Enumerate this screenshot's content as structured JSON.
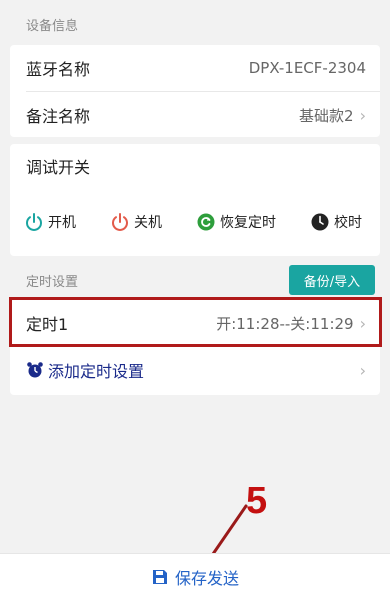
{
  "device_info": {
    "header": "设备信息",
    "bluetooth_label": "蓝牙名称",
    "bluetooth_value": "DPX-1ECF-2304",
    "note_label": "备注名称",
    "note_value": "基础款2"
  },
  "debug": {
    "title": "调试开关",
    "power_on": "开机",
    "power_off": "关机",
    "restore_timer": "恢复定时",
    "calibrate_time": "校时"
  },
  "timer_settings": {
    "header": "定时设置",
    "backup_button": "备份/导入",
    "timer1_label": "定时1",
    "timer1_value": "开:11:28--关:11:29",
    "add_timer": "添加定时设置"
  },
  "bottom": {
    "save_send": "保存发送"
  },
  "annotation": {
    "step_number": "5"
  },
  "colors": {
    "accent_teal": "#1aa5a1",
    "power_off_red": "#e35b4b",
    "restore_green": "#2e9e3c",
    "save_blue": "#2463c7",
    "highlight_red": "#b01a1a"
  }
}
